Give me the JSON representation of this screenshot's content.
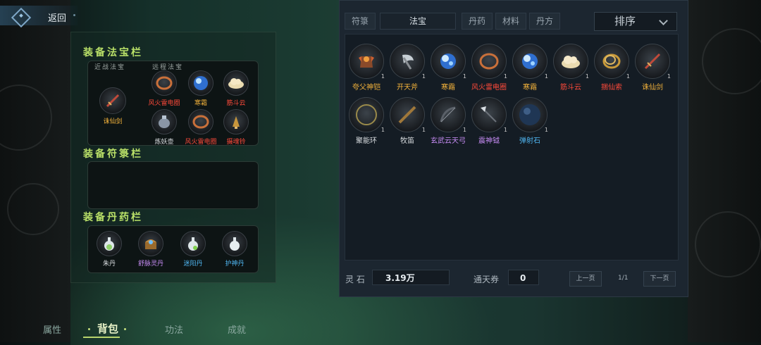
{
  "nav": {
    "back_label": "返回"
  },
  "equip": {
    "fabao_title": "装备法宝栏",
    "melee_label": "近战法宝",
    "ranged_label": "远程法宝",
    "melee_items": [
      {
        "name": "诛仙剑",
        "icon": "sword-icon",
        "color": "orange"
      }
    ],
    "ranged_items": [
      {
        "name": "风火雷电圈",
        "icon": "fire-ring-icon",
        "color": "red"
      },
      {
        "name": "寒霜",
        "icon": "frost-orb-icon",
        "color": "orange"
      },
      {
        "name": "筋斗云",
        "icon": "cloud-icon",
        "color": "red"
      },
      {
        "name": "炼妖壶",
        "icon": "demon-pot-icon",
        "color": "white"
      },
      {
        "name": "风火雷电圈",
        "icon": "fire-ring-icon",
        "color": "red"
      },
      {
        "name": "摄魂铃",
        "icon": "soul-bell-icon",
        "color": "red"
      }
    ],
    "talisman_title": "装备符箓栏",
    "pill_title": "装备丹药栏",
    "pills": [
      {
        "name": "朱丹",
        "icon": "potion-icon",
        "color": "white"
      },
      {
        "name": "舒脉灵丹",
        "icon": "treasure-chest-icon",
        "color": "purple"
      },
      {
        "name": "迷阳丹",
        "icon": "potion-icon",
        "color": "blue"
      },
      {
        "name": "护神丹",
        "icon": "potion-icon",
        "color": "blue"
      }
    ]
  },
  "bottom_tabs": [
    "属性",
    "背包",
    "功法",
    "成就"
  ],
  "inventory": {
    "tabs": [
      "符箓",
      "法宝",
      "丹药",
      "材料",
      "丹方"
    ],
    "sort_label": "排序",
    "items": [
      {
        "name": "夸父神铠",
        "qty": "1",
        "color": "orange",
        "icon": "armor-icon"
      },
      {
        "name": "开天斧",
        "qty": "1",
        "color": "orange",
        "icon": "axe-icon"
      },
      {
        "name": "寒霜",
        "qty": "1",
        "color": "orange",
        "icon": "frost-orb-icon"
      },
      {
        "name": "风火雷电圈",
        "qty": "1",
        "color": "red",
        "icon": "fire-ring-icon"
      },
      {
        "name": "寒霜",
        "qty": "1",
        "color": "orange",
        "icon": "frost-orb-icon"
      },
      {
        "name": "筋斗云",
        "qty": "1",
        "color": "red",
        "icon": "cloud-icon"
      },
      {
        "name": "捆仙索",
        "qty": "1",
        "color": "red",
        "icon": "rope-icon"
      },
      {
        "name": "诛仙剑",
        "qty": "1",
        "color": "orange",
        "icon": "sword-icon"
      },
      {
        "name": "聚能环",
        "qty": "1",
        "color": "white",
        "icon": "ring-icon"
      },
      {
        "name": "牧笛",
        "qty": "1",
        "color": "white",
        "icon": "flute-icon"
      },
      {
        "name": "玄武云天弓",
        "qty": "1",
        "color": "purple",
        "icon": "bow-icon"
      },
      {
        "name": "震神钺",
        "qty": "1",
        "color": "purple",
        "icon": "halberd-icon"
      },
      {
        "name": "弹射石",
        "qty": "1",
        "color": "blue",
        "icon": "stone-icon"
      }
    ]
  },
  "footer": {
    "lingshi_label": "灵 石",
    "lingshi_value": "3.19万",
    "ticket_label": "通天券",
    "ticket_value": "0",
    "prev_label": "上一页",
    "page": "1/1",
    "next_label": "下一页"
  },
  "colors": {
    "orange": "#f3b23b",
    "red": "#ff4a3a",
    "purple": "#c78cf5",
    "blue": "#4fb5f0",
    "white": "#d9dde0",
    "accent": "#b9e068"
  }
}
